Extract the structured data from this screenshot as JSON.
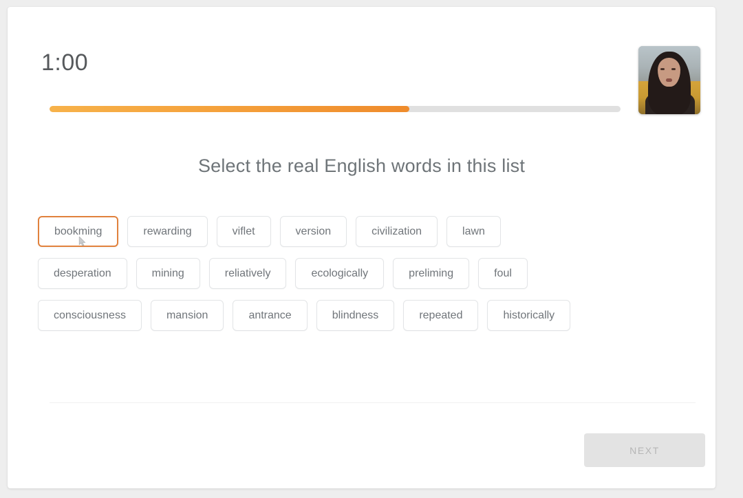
{
  "quiz": {
    "timer": "1:00",
    "progress_percent": 63,
    "question": "Select the real English words in this list",
    "word_rows": [
      [
        {
          "label": "bookming",
          "state": "hovered"
        },
        {
          "label": "rewarding",
          "state": "default"
        },
        {
          "label": "viflet",
          "state": "default"
        },
        {
          "label": "version",
          "state": "default"
        },
        {
          "label": "civilization",
          "state": "default"
        },
        {
          "label": "lawn",
          "state": "default"
        }
      ],
      [
        {
          "label": "desperation",
          "state": "default"
        },
        {
          "label": "mining",
          "state": "default"
        },
        {
          "label": "reliatively",
          "state": "default"
        },
        {
          "label": "ecologically",
          "state": "default"
        },
        {
          "label": "preliming",
          "state": "default"
        },
        {
          "label": "foul",
          "state": "default"
        }
      ],
      [
        {
          "label": "consciousness",
          "state": "default"
        },
        {
          "label": "mansion",
          "state": "default"
        },
        {
          "label": "antrance",
          "state": "default"
        },
        {
          "label": "blindness",
          "state": "default"
        },
        {
          "label": "repeated",
          "state": "default"
        },
        {
          "label": "historically",
          "state": "default"
        }
      ]
    ],
    "next_label": "NEXT",
    "next_disabled": true,
    "webcam_label": "webcam-preview",
    "colors": {
      "accent": "#ef8b2c",
      "accent_light": "#f7b24a",
      "track": "#e0e0e0",
      "text": "#6e7478",
      "button_border": "#e2e4e6",
      "hover_border": "#e1813c",
      "next_bg": "#e3e3e3",
      "next_text": "#b6b6b6"
    }
  }
}
